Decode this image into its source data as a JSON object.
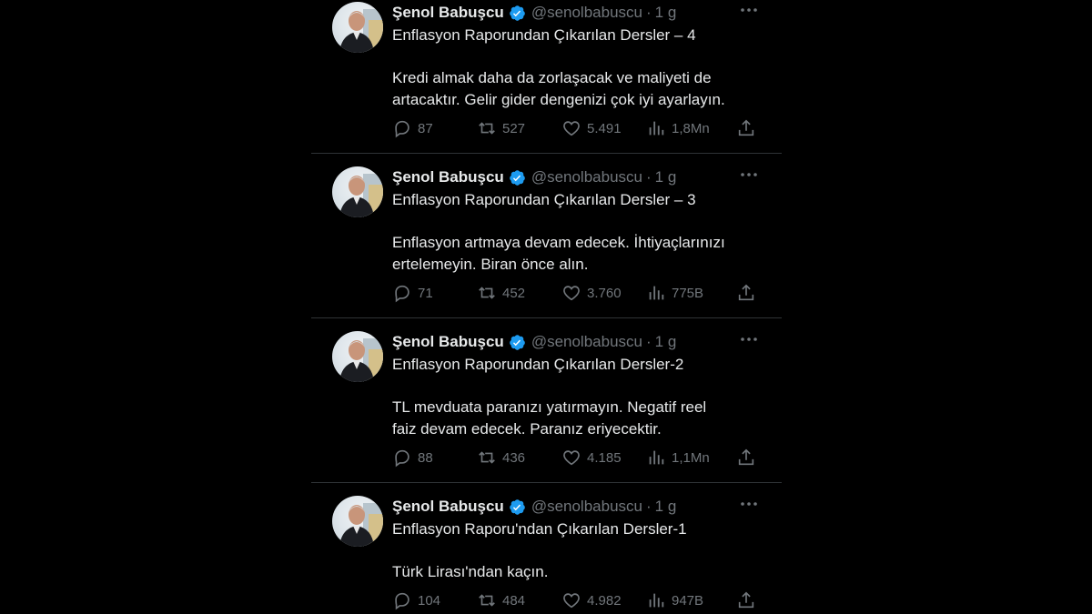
{
  "colors": {
    "background": "#000000",
    "text": "#e7e9ea",
    "muted": "#71767b",
    "divider": "#2f3336",
    "verified": "#1d9bf0"
  },
  "tweets": [
    {
      "name": "Şenol Babuşcu",
      "handle": "@senolbabuscu",
      "separator": "·",
      "time": "1 g",
      "title": "Enflasyon Raporundan Çıkarılan Dersler – 4",
      "body": [
        "Kredi almak daha da zorlaşacak ve maliyeti de",
        "artacaktır. Gelir gider dengenizi çok iyi ayarlayın."
      ],
      "replies": "87",
      "retweets": "527",
      "likes": "5.491",
      "views": "1,8Mn"
    },
    {
      "name": "Şenol Babuşcu",
      "handle": "@senolbabuscu",
      "separator": "·",
      "time": "1 g",
      "title": "Enflasyon Raporundan Çıkarılan Dersler – 3",
      "body": [
        "Enflasyon artmaya devam edecek. İhtiyaçlarınızı",
        "ertelemeyin. Biran önce alın."
      ],
      "replies": "71",
      "retweets": "452",
      "likes": "3.760",
      "views": "775B"
    },
    {
      "name": "Şenol Babuşcu",
      "handle": "@senolbabuscu",
      "separator": "·",
      "time": "1 g",
      "title": "Enflasyon Raporundan Çıkarılan Dersler-2",
      "body": [
        "TL mevduata paranızı yatırmayın. Negatif reel",
        "faiz devam edecek. Paranız eriyecektir."
      ],
      "replies": "88",
      "retweets": "436",
      "likes": "4.185",
      "views": "1,1Mn"
    },
    {
      "name": "Şenol Babuşcu",
      "handle": "@senolbabuscu",
      "separator": "·",
      "time": "1 g",
      "title": "Enflasyon Raporu'ndan Çıkarılan Dersler-1",
      "body": [
        "Türk Lirası'ndan kaçın."
      ],
      "replies": "104",
      "retweets": "484",
      "likes": "4.982",
      "views": "947B"
    }
  ]
}
